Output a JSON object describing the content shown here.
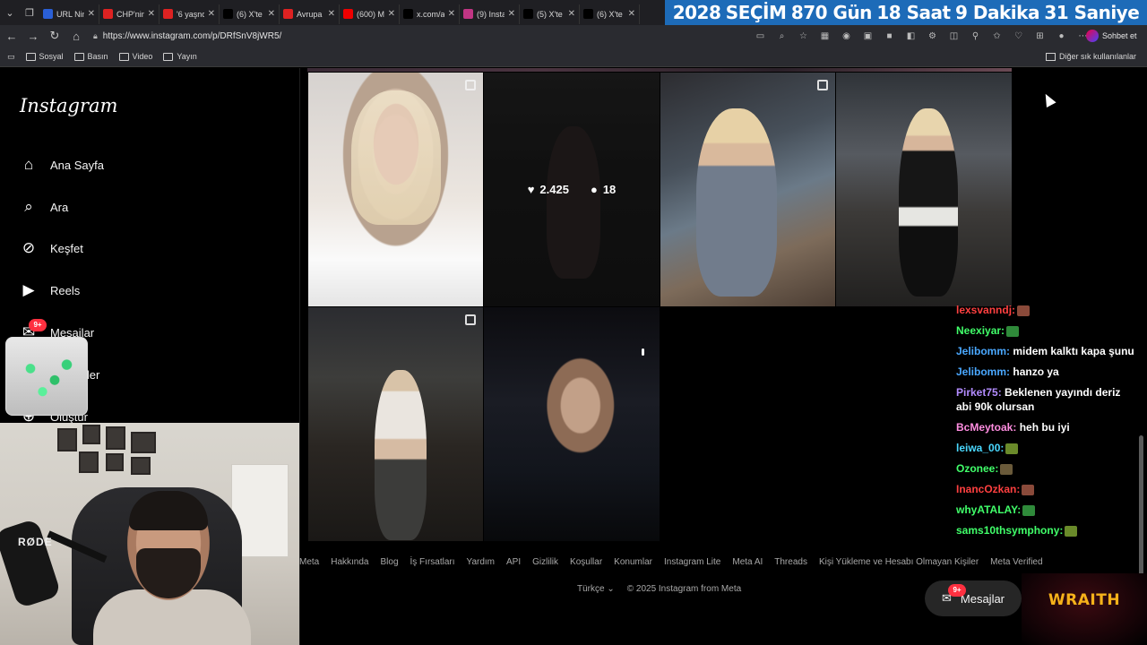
{
  "browser": {
    "tabs": [
      {
        "label": "URL Nin",
        "fav_color": "#2a5fd6"
      },
      {
        "label": "CHP'nin",
        "fav_color": "#d22"
      },
      {
        "label": "'6 yaşnc",
        "fav_color": "#d22"
      },
      {
        "label": "(6) X'te",
        "fav_color": "#000"
      },
      {
        "label": "Avrupa",
        "fav_color": "#d22"
      },
      {
        "label": "(600) M",
        "fav_color": "#e00"
      },
      {
        "label": "x.com/a",
        "fav_color": "#000"
      },
      {
        "label": "(9) Insta",
        "fav_color": "#c13584"
      },
      {
        "label": "(5) X'te",
        "fav_color": "#000"
      },
      {
        "label": "(6) X'te",
        "fav_color": "#000"
      }
    ],
    "url": "https://www.instagram.com/p/DRfSnV8jWR5/",
    "chat_button": "Sohbet et",
    "bookmarks": [
      "Sosyal",
      "Basın",
      "Video",
      "Yayın"
    ],
    "bookmarks_other": "Diğer sık kullanılanlar"
  },
  "countdown": {
    "year": "2028",
    "label": "SEÇİM",
    "days": "870 Gün",
    "hours": "18 Saat",
    "minutes": "9  Dakika",
    "seconds": "31 Saniye"
  },
  "instagram": {
    "logo": "Instagram",
    "nav": [
      {
        "label": "Ana Sayfa",
        "icon": "home-icon"
      },
      {
        "label": "Ara",
        "icon": "search-icon"
      },
      {
        "label": "Keşfet",
        "icon": "compass-icon"
      },
      {
        "label": "Reels",
        "icon": "reels-icon"
      },
      {
        "label": "Mesajlar",
        "icon": "messenger-icon"
      },
      {
        "label": "mler",
        "icon": "heart-icon"
      },
      {
        "label": "Oluştur",
        "icon": "plus-icon"
      }
    ],
    "messages_badge": "9+",
    "hovered_post": {
      "likes": "2.425",
      "comments": "18"
    },
    "footer_links": [
      "Meta",
      "Hakkında",
      "Blog",
      "İş Fırsatları",
      "Yardım",
      "API",
      "Gizlilik",
      "Koşullar",
      "Konumlar",
      "Instagram Lite",
      "Meta AI",
      "Threads",
      "Kişi Yükleme ve Hesabı Olmayan Kişiler",
      "Meta Verified"
    ],
    "language": "Türkçe",
    "copyright": "© 2025 Instagram from Meta",
    "messages_pill": {
      "label": "Mesajlar",
      "badge": "9+"
    }
  },
  "chat": [
    {
      "user": "lexsvanndj:",
      "text": "",
      "color": "#ff4040"
    },
    {
      "user": "Neexiyar:",
      "text": "",
      "color": "#41ff6a"
    },
    {
      "user": "Jelibomm:",
      "text": "midem kalktı kapa şunu",
      "color": "#4aa8ff"
    },
    {
      "user": "Jelibomm:",
      "text": "hanzo ya",
      "color": "#4aa8ff"
    },
    {
      "user": "Pirket75:",
      "text": "Beklenen yayındı deriz abi 90k olursan",
      "color": "#b38cff"
    },
    {
      "user": "BcMeytoak:",
      "text": "heh bu iyi",
      "color": "#ff8de0"
    },
    {
      "user": "leiwa_00:",
      "text": "",
      "color": "#4ad8ff"
    },
    {
      "user": "Ozonee:",
      "text": "",
      "color": "#41ff6a"
    },
    {
      "user": "InancOzkan:",
      "text": "",
      "color": "#ff4040"
    },
    {
      "user": "whyATALAY:",
      "text": "",
      "color": "#41ff6a"
    },
    {
      "user": "sams10thsymphony:",
      "text": "",
      "color": "#41ff6a"
    }
  ],
  "overlay": {
    "brand": "WRAITH",
    "mic_brand": "RØDE"
  }
}
